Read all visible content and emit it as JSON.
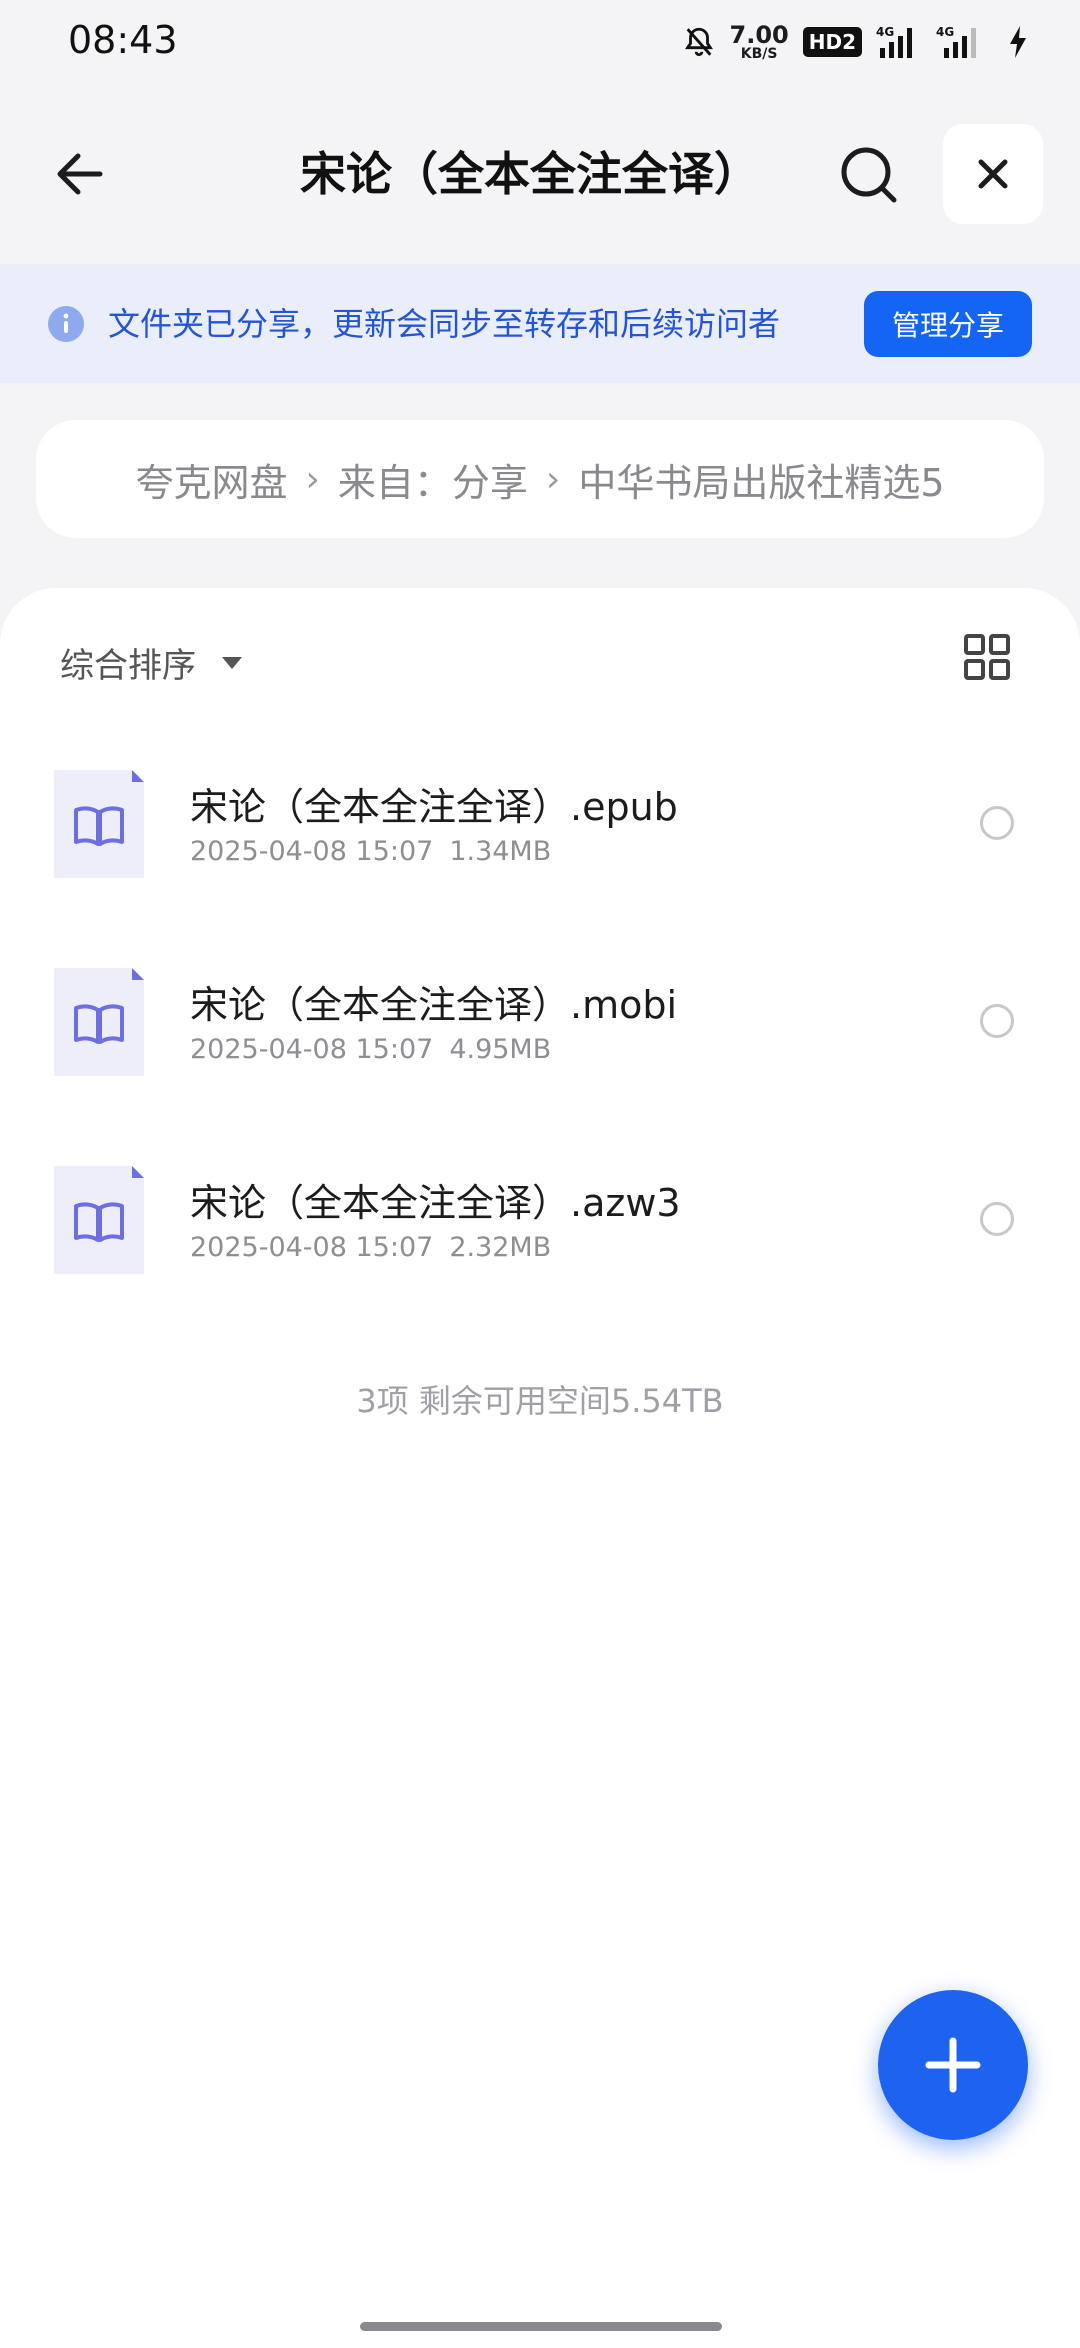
{
  "status_bar": {
    "time": "08:43",
    "network_speed_value": "7.00",
    "network_speed_unit": "KB/S",
    "hd_badge": "HD2",
    "signal_label_1": "4G",
    "signal_label_2": "4G",
    "icons": [
      "bell-muted-icon",
      "signal-icon",
      "signal-icon",
      "charging-bolt-icon"
    ]
  },
  "nav": {
    "title": "宋论（全本全注全译）",
    "back_icon": "arrow-left-icon",
    "search_icon": "search-icon",
    "close_icon": "close-icon"
  },
  "banner": {
    "text": "文件夹已分享，更新会同步至转存和后续访问者",
    "button": "管理分享",
    "icon": "info-icon"
  },
  "breadcrumbs": [
    "夸克网盘",
    "来自：分享",
    "中华书局出版社精选5"
  ],
  "sort": {
    "label": "综合排序"
  },
  "files": [
    {
      "name": "宋论（全本全注全译）.epub",
      "date": "2025-04-08 15:07",
      "size": "1.34MB"
    },
    {
      "name": "宋论（全本全注全译）.mobi",
      "date": "2025-04-08 15:07",
      "size": "4.95MB"
    },
    {
      "name": "宋论（全本全注全译）.azw3",
      "date": "2025-04-08 15:07",
      "size": "2.32MB"
    }
  ],
  "footer": {
    "summary": "3项 剩余可用空间5.54TB"
  },
  "colors": {
    "accent": "#1565f5",
    "banner_bg": "#e9eefa",
    "banner_text": "#2455d6",
    "file_icon": "#6d6ee0"
  }
}
